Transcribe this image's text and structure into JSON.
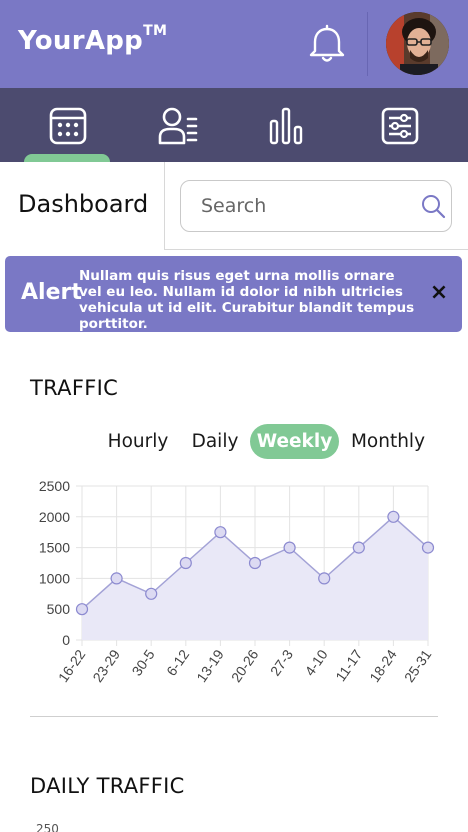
{
  "header": {
    "app_name": "YourApp",
    "trademark": "TM",
    "brand_color": "#7a78c5",
    "notification_icon": "bell-icon",
    "avatar_icon": "user-avatar"
  },
  "nav": {
    "background": "#4c4b6f",
    "active_color": "#81c995",
    "tabs": [
      {
        "icon": "calendar-icon",
        "active": true
      },
      {
        "icon": "users-list-icon",
        "active": false
      },
      {
        "icon": "bar-chart-icon",
        "active": false
      },
      {
        "icon": "sliders-icon",
        "active": false
      }
    ]
  },
  "page": {
    "title": "Dashboard"
  },
  "search": {
    "placeholder": "Search",
    "value": ""
  },
  "alert": {
    "label": "Alert",
    "message": "Nullam quis risus eget urna mollis ornare vel eu leo. Nullam id dolor id nibh ultricies vehicula ut id elit. Curabitur blandit tempus porttitor.",
    "close_symbol": "×"
  },
  "traffic": {
    "title": "TRAFFIC",
    "periods": [
      "Hourly",
      "Daily",
      "Weekly",
      "Monthly"
    ],
    "selected_period": "Weekly"
  },
  "daily_traffic": {
    "title": "DAILY TRAFFIC",
    "first_tick": "250"
  },
  "chart_data": {
    "type": "area",
    "categories": [
      "16-22",
      "23-29",
      "30-5",
      "6-12",
      "13-19",
      "20-26",
      "27-3",
      "4-10",
      "11-17",
      "18-24",
      "25-31"
    ],
    "values": [
      500,
      1000,
      750,
      1250,
      1750,
      1250,
      1500,
      1000,
      1500,
      2000,
      1500
    ],
    "y_ticks": [
      0,
      500,
      1000,
      1500,
      2000,
      2500
    ],
    "ylim": [
      0,
      2500
    ],
    "grid": true,
    "line_color": "#a3a2d6",
    "fill_color": "#e9e8f7"
  }
}
